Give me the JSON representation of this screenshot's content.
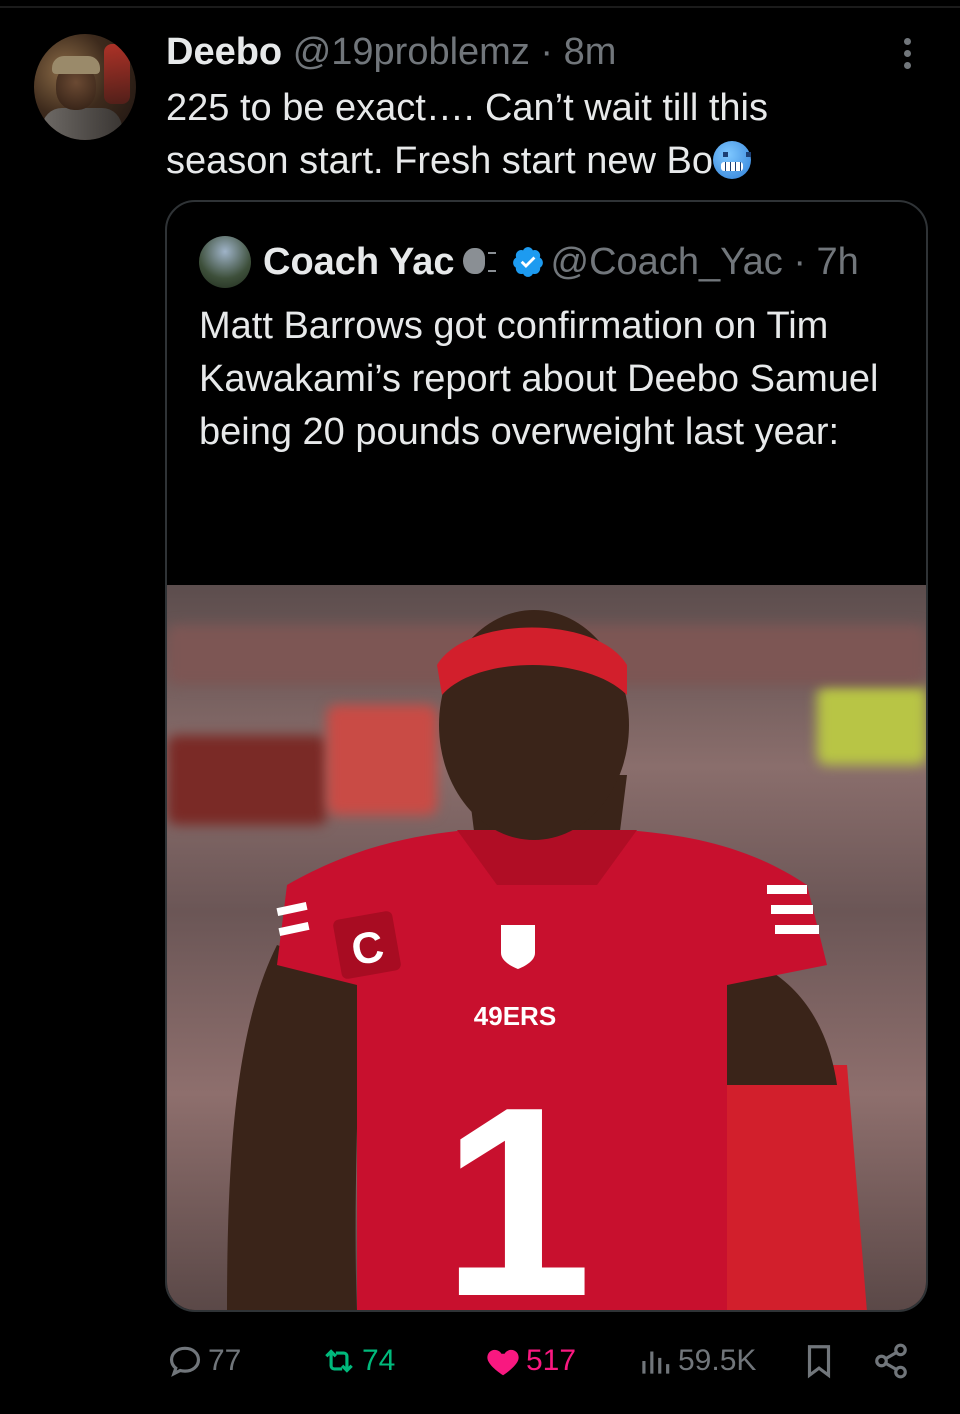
{
  "tweet": {
    "author_name": "Deebo",
    "author_handle": "@19problemz",
    "separator": "·",
    "time": "8m",
    "text_line1": "225 to be exact…. Can’t wait till this",
    "text_line2": "season start. Fresh start new Bo",
    "emoji_name": "cold-face-emoji"
  },
  "quote": {
    "author_name": "Coach Yac",
    "author_handle": "@Coach_Yac",
    "separator": "·",
    "time": "7h",
    "text": "Matt Barrows got confirmation on Tim Kawakami’s report about Deebo Samuel being 20 pounds overweight last year:",
    "ellipsis": "...",
    "image": {
      "jersey_wordmark": "49ERS",
      "jersey_number": "1",
      "patch_letter": "C"
    }
  },
  "actions": {
    "replies": "77",
    "reposts": "74",
    "likes": "517",
    "views": "59.5K"
  },
  "colors": {
    "background": "#000000",
    "text": "#e7e9ea",
    "muted": "#71767b",
    "border": "#2f3336",
    "verified": "#1d9bf0",
    "repost": "#00ba7c",
    "like": "#f91880",
    "jersey_red": "#c8102e"
  }
}
